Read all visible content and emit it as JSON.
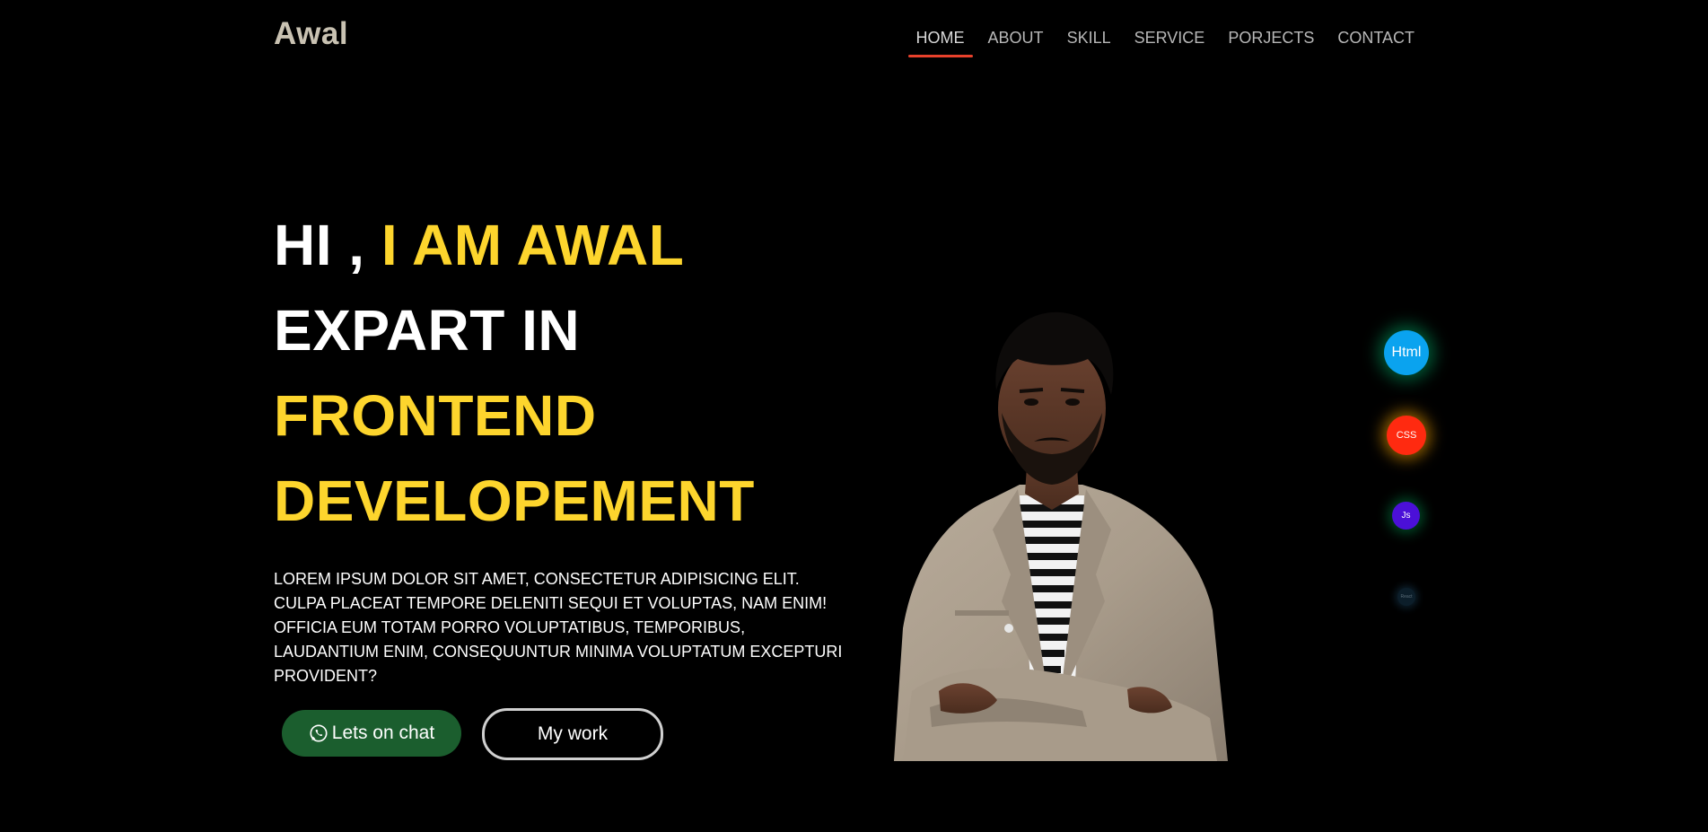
{
  "header": {
    "logo": "Awal",
    "nav": [
      {
        "label": "HOME",
        "active": true
      },
      {
        "label": "ABOUT",
        "active": false
      },
      {
        "label": "SKILL",
        "active": false
      },
      {
        "label": "SERVICE",
        "active": false
      },
      {
        "label": "PORJECTS",
        "active": false
      },
      {
        "label": "CONTACT",
        "active": false
      }
    ]
  },
  "hero": {
    "line1_prefix": "HI ,",
    "line1_highlight": "I AM AWAL",
    "line2": "EXPART IN",
    "line3": "FRONTEND",
    "line4": "DEVELOPEMENT",
    "description": "LOREM IPSUM DOLOR SIT AMET, CONSECTETUR ADIPISICING ELIT. CULPA PLACEAT TEMPORE DELENITI SEQUI ET VOLUPTAS, NAM ENIM! OFFICIA EUM TOTAM PORRO VOLUPTATIBUS, TEMPORIBUS, LAUDANTIUM ENIM, CONSEQUUNTUR MINIMA VOLUPTATUM EXCEPTURI PROVIDENT?",
    "chat_button": "Lets on chat",
    "chat_icon": "whatsapp-icon",
    "work_button": "My work"
  },
  "skills": [
    {
      "label": "Html",
      "color": "#0aa3ef"
    },
    {
      "label": "CSS",
      "color": "#ff2a10"
    },
    {
      "label": "Js",
      "color": "#4b10d8"
    },
    {
      "label": "React",
      "color": "#0c1e2a"
    }
  ],
  "colors": {
    "background": "#000000",
    "accent_yellow": "#fdd52d",
    "nav_underline": "#e8412b",
    "chat_button": "#1b5e2e",
    "logo": "#c9c2b2"
  }
}
